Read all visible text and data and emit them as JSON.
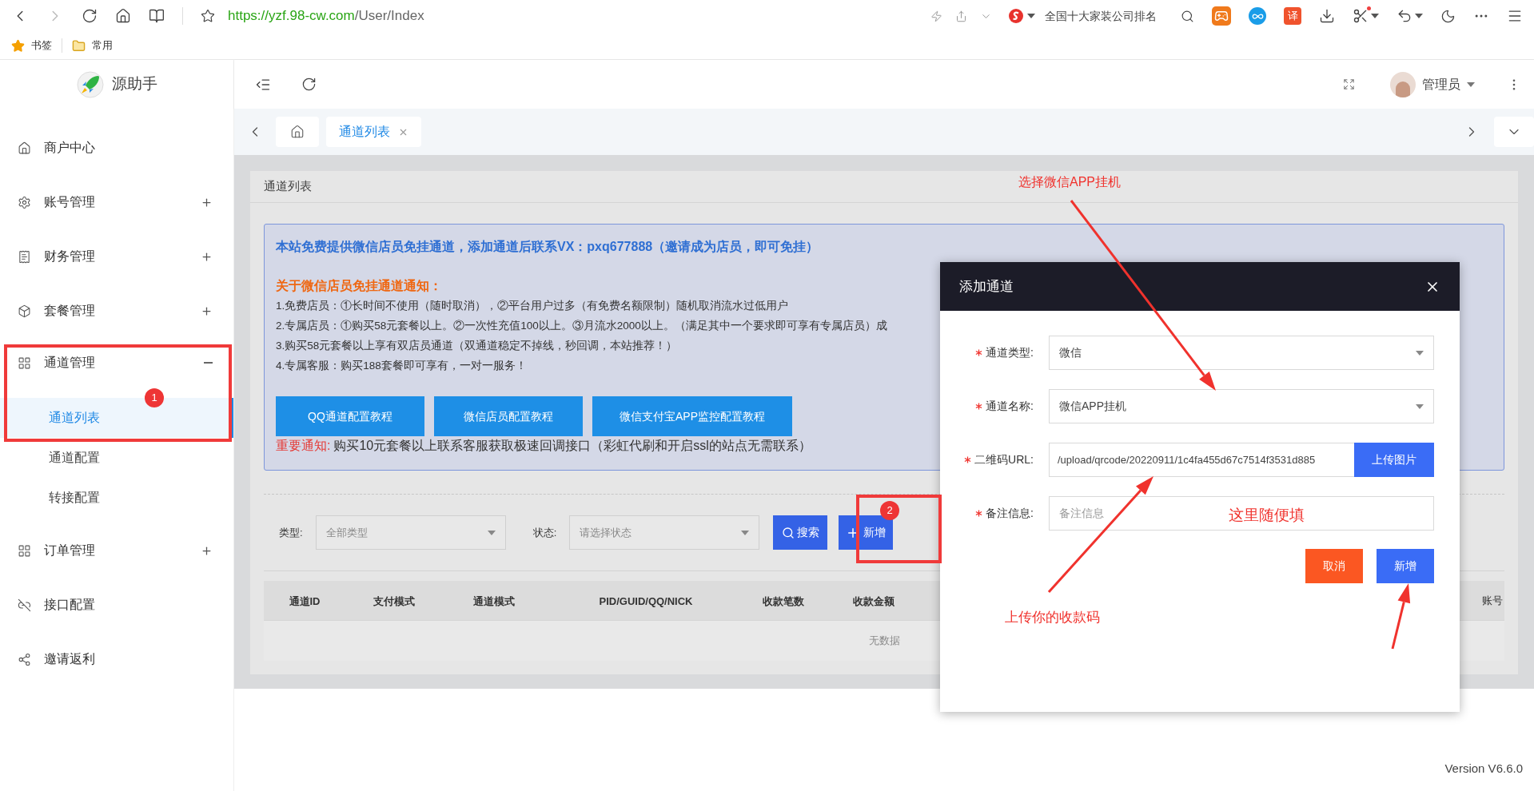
{
  "browser": {
    "url_host": "https://yzf.98-cw.com",
    "url_path": "/User/Index",
    "search_suggestion": "全国十大家装公司排名",
    "translate_badge": "译",
    "bookmarks": [
      "书签",
      "常用"
    ]
  },
  "sidebar": {
    "brand": "源助手",
    "items": [
      {
        "label": "商户中心"
      },
      {
        "label": "账号管理",
        "expanded": false
      },
      {
        "label": "财务管理",
        "expanded": false
      },
      {
        "label": "套餐管理",
        "expanded": false
      },
      {
        "label": "通道管理",
        "expanded": true,
        "children": [
          {
            "label": "通道列表",
            "selected": true
          },
          {
            "label": "通道配置",
            "selected": false
          },
          {
            "label": "转接配置",
            "selected": false
          }
        ]
      },
      {
        "label": "订单管理",
        "expanded": false
      },
      {
        "label": "接口配置"
      },
      {
        "label": "邀请返利"
      }
    ]
  },
  "header": {
    "user": "管理员"
  },
  "tabs": [
    {
      "label": "通道列表",
      "selected": true
    }
  ],
  "page": {
    "title": "通道列表",
    "notice": {
      "headline": "本站免费提供微信店员免挂通道，添加通道后联系VX：pxq677888（邀请成为店员，即可免挂）",
      "subheading": "关于微信店员免挂通道通知：",
      "lines": [
        "1.免费店员：①长时间不使用（随时取消），②平台用户过多（有免费名额限制）随机取消流水过低用户",
        "2.专属店员：①购买58元套餐以上。②一次性充值100以上。③月流水2000以上。（满足其中一个要求即可享有专属店员）成",
        "3.购买58元套餐以上享有双店员通道（双通道稳定不掉线，秒回调，本站推荐！）",
        "4.专属客服：购买188套餐即可享有，一对一服务！"
      ],
      "buttons": [
        "QQ通道配置教程",
        "微信店员配置教程",
        "微信支付宝APP监控配置教程"
      ],
      "important_label": "重要通知:",
      "important_text": "购买10元套餐以上联系客服获取极速回调接口（彩虹代刷和开启ssl的站点无需联系）"
    },
    "filters": [
      {
        "label": "类型:",
        "placeholder": "全部类型"
      },
      {
        "label": "状态:",
        "placeholder": "请选择状态"
      }
    ],
    "search_button": "搜索",
    "add_button": "新增",
    "table": {
      "columns": [
        "通道ID",
        "支付模式",
        "通道模式",
        "PID/GUID/QQ/NICK",
        "收款笔数",
        "收款金额"
      ],
      "last_column": "账号",
      "empty_text": "无数据"
    }
  },
  "modal": {
    "title": "添加通道",
    "fields": [
      {
        "kind": "select",
        "label": "通道类型:",
        "required": true,
        "value": "微信"
      },
      {
        "kind": "select",
        "label": "通道名称:",
        "required": true,
        "value": "微信APP挂机"
      },
      {
        "kind": "upload",
        "label": "二维码URL:",
        "required": true,
        "value": "/upload/qrcode/20220911/1c4fa455d67c7514f3531d885",
        "button": "上传图片"
      },
      {
        "kind": "text",
        "label": "备注信息:",
        "required": true,
        "placeholder": "备注信息"
      }
    ],
    "buttons": [
      {
        "kind": "cancel",
        "label": "取消"
      },
      {
        "kind": "primary",
        "label": "新增"
      }
    ]
  },
  "annotations": {
    "callouts": [
      "选择微信APP挂机",
      "这里随便填",
      "上传你的收款码"
    ],
    "step_badges": [
      "1",
      "2"
    ]
  },
  "footer": {
    "version": "Version V6.6.0"
  }
}
